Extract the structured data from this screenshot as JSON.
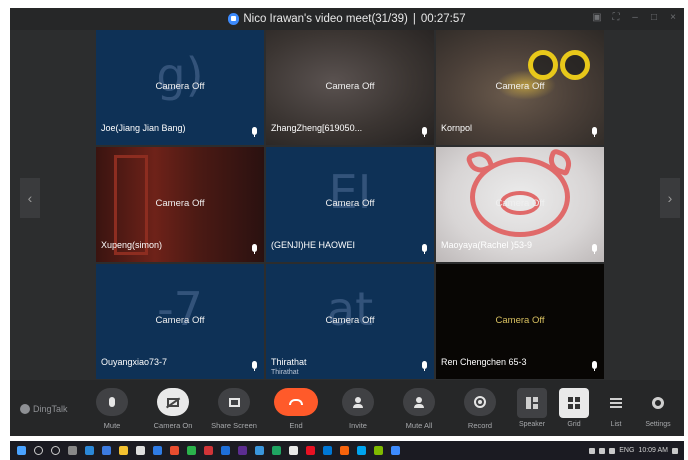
{
  "window": {
    "title": "Nico Irawan's video meet(31/39)",
    "separator": "|",
    "timer": "00:27:57"
  },
  "tiles": [
    {
      "name": "Joe(Jiang Jian Bang)",
      "status": "Camera Off",
      "avatar": "g)"
    },
    {
      "name": "ZhangZheng[619050...",
      "status": "Camera Off",
      "avatar": ""
    },
    {
      "name": "Kornpol",
      "status": "Camera Off",
      "avatar": ""
    },
    {
      "name": "Xupeng(simon)",
      "status": "Camera Off",
      "avatar": ""
    },
    {
      "name": "(GENJI)HE HAOWEI",
      "status": "Camera Off",
      "avatar": "EI"
    },
    {
      "name": "Maoyaya(Rachel )53-9",
      "status": "Camera Off",
      "avatar": ""
    },
    {
      "name": "Ouyangxiao73-7",
      "status": "Camera Off",
      "avatar": "-7"
    },
    {
      "name": "Thirathat",
      "subname": "Thirathat",
      "status": "Camera Off",
      "avatar": "at"
    },
    {
      "name": "Ren Chengchen 65-3",
      "status": "Camera Off",
      "avatar": ""
    }
  ],
  "toolbar": {
    "brand": "DingTalk",
    "mute": "Mute",
    "camera_on": "Camera On",
    "share_screen": "Share Screen",
    "end": "End",
    "invite": "Invite",
    "mute_all": "Mute All",
    "record": "Record",
    "speaker": "Speaker",
    "grid": "Grid",
    "list": "List",
    "settings": "Settings"
  },
  "taskbar": {
    "language": "ENG",
    "time": "10:09 AM"
  },
  "colors": {
    "end_button": "#ff5a2a",
    "tile_blue": "#0e3156",
    "background": "#262728"
  }
}
